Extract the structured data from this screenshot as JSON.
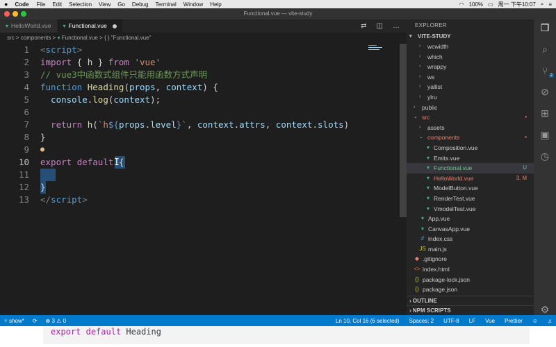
{
  "menubar": {
    "apple": "",
    "app": "Code",
    "items": [
      "File",
      "Edit",
      "Selection",
      "View",
      "Go",
      "Debug",
      "Terminal",
      "Window",
      "Help"
    ],
    "battery": "100%",
    "clock": "周一 下午10:07"
  },
  "window": {
    "title": "Functional.vue — vite-study"
  },
  "tabs": [
    {
      "label": "HelloWorld.vue",
      "active": false
    },
    {
      "label": "Functional.vue",
      "active": true,
      "modified": true
    }
  ],
  "breadcrumb": {
    "parts": [
      "src",
      ">",
      "components",
      ">",
      "Functional.vue",
      ">",
      "{ } \"Functional.vue\""
    ]
  },
  "editor": {
    "lines": [
      {
        "n": "1"
      },
      {
        "n": "2"
      },
      {
        "n": "3"
      },
      {
        "n": "4"
      },
      {
        "n": "5"
      },
      {
        "n": "6"
      },
      {
        "n": "7"
      },
      {
        "n": "8"
      },
      {
        "n": "9"
      },
      {
        "n": "10"
      },
      {
        "n": "11"
      },
      {
        "n": "12"
      },
      {
        "n": "13"
      }
    ],
    "code": {
      "l1a": "<",
      "l1b": "script",
      "l1c": ">",
      "l2a": "import",
      "l2b": " { h } ",
      "l2c": "from",
      "l2d": " ",
      "l2e": "'vue'",
      "l3": "// vue3中函数式组件只能用函数方式声明",
      "l4a": "function",
      "l4b": " ",
      "l4c": "Heading",
      "l4d": "(",
      "l4e": "props",
      "l4f": ", ",
      "l4g": "context",
      "l4h": ") {",
      "l5a": "  console",
      "l5b": ".",
      "l5c": "log",
      "l5d": "(",
      "l5e": "context",
      "l5f": ");",
      "l7a": "  return",
      "l7b": " ",
      "l7c": "h",
      "l7d": "(",
      "l7e": "`h",
      "l7f": "${",
      "l7g": "props",
      "l7h": ".",
      "l7i": "level",
      "l7j": "}",
      "l7k": "`",
      "l7l": ", ",
      "l7m": "context",
      "l7n": ".",
      "l7o": "attrs",
      "l7p": ", ",
      "l7q": "context",
      "l7r": ".",
      "l7s": "slots",
      "l7t": ")",
      "l8": "}",
      "l10a": "export",
      "l10b": " ",
      "l10c": "default",
      "l10d": " {",
      "l12": "}",
      "l13a": "</",
      "l13b": "script",
      "l13c": ">"
    }
  },
  "explorer": {
    "title": "EXPLORER",
    "project": "VITE-STUDY",
    "items": [
      {
        "label": "wcwidth",
        "indent": 2,
        "type": "folder-closed"
      },
      {
        "label": "which",
        "indent": 2,
        "type": "folder-closed"
      },
      {
        "label": "wrappy",
        "indent": 2,
        "type": "folder-closed"
      },
      {
        "label": "ws",
        "indent": 2,
        "type": "folder-closed"
      },
      {
        "label": "yallist",
        "indent": 2,
        "type": "folder-closed"
      },
      {
        "label": "ylru",
        "indent": 2,
        "type": "folder-closed"
      },
      {
        "label": "public",
        "indent": 1,
        "type": "folder-closed"
      },
      {
        "label": "src",
        "indent": 1,
        "type": "folder-open",
        "color": "#e8826f",
        "badge": "•"
      },
      {
        "label": "assets",
        "indent": 2,
        "type": "folder-closed"
      },
      {
        "label": "components",
        "indent": 2,
        "type": "folder-open",
        "color": "#e8826f",
        "badge": "•"
      },
      {
        "label": "Composition.vue",
        "indent": 3,
        "type": "vue"
      },
      {
        "label": "Emits.vue",
        "indent": 3,
        "type": "vue"
      },
      {
        "label": "Functional.vue",
        "indent": 3,
        "type": "vue",
        "color": "#73c991",
        "badge": "U",
        "selected": true
      },
      {
        "label": "HelloWorld.vue",
        "indent": 3,
        "type": "vue",
        "color": "#e8826f",
        "badge": "3, M"
      },
      {
        "label": "ModelButton.vue",
        "indent": 3,
        "type": "vue"
      },
      {
        "label": "RenderTest.vue",
        "indent": 3,
        "type": "vue"
      },
      {
        "label": "VmodelTest.vue",
        "indent": 3,
        "type": "vue"
      },
      {
        "label": "App.vue",
        "indent": 2,
        "type": "vue"
      },
      {
        "label": "CanvasApp.vue",
        "indent": 2,
        "type": "vue"
      },
      {
        "label": "index.css",
        "indent": 2,
        "type": "css"
      },
      {
        "label": "main.js",
        "indent": 2,
        "type": "js"
      },
      {
        "label": ".gitignore",
        "indent": 1,
        "type": "git"
      },
      {
        "label": "index.html",
        "indent": 1,
        "type": "html"
      },
      {
        "label": "package-lock.json",
        "indent": 1,
        "type": "json"
      },
      {
        "label": "package.json",
        "indent": 1,
        "type": "json"
      }
    ],
    "outline": "OUTLINE",
    "npm": "NPM SCRIPTS"
  },
  "status": {
    "branch": "show*",
    "problems": "3",
    "warnings": "0",
    "position": "Ln 10, Col 16 (6 selected)",
    "spaces": "Spaces: 2",
    "encoding": "UTF-8",
    "eol": "LF",
    "language": "Vue",
    "formatter": "Prettier"
  },
  "caption": {
    "k1": "export",
    "k2": "default",
    "t": "Heading"
  },
  "colors": {
    "accent": "#007acc",
    "vue": "#41b883"
  }
}
